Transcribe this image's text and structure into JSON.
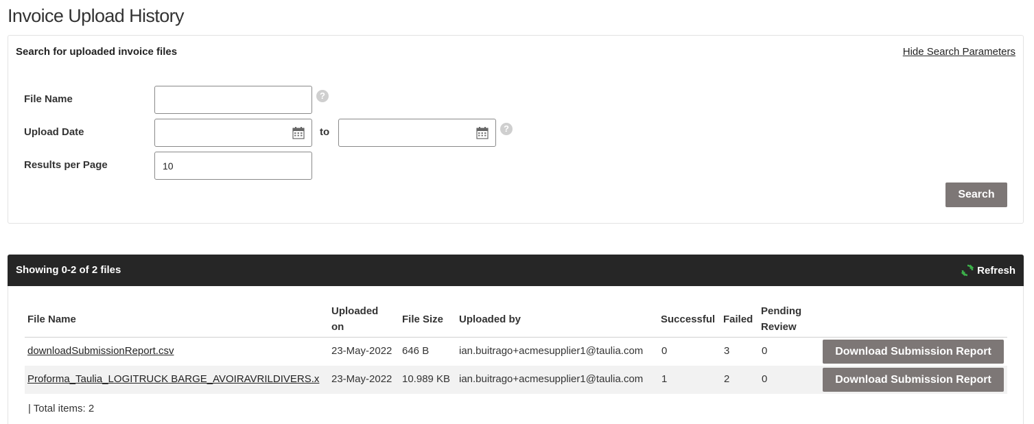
{
  "page": {
    "title": "Invoice Upload History"
  },
  "search": {
    "heading": "Search for uploaded invoice files",
    "hide_link": "Hide Search Parameters",
    "file_name_label": "File Name",
    "file_name_value": "",
    "upload_date_label": "Upload Date",
    "to_label": "to",
    "date_from_value": "",
    "date_to_value": "",
    "results_per_page_label": "Results per Page",
    "results_per_page_value": "10",
    "search_button": "Search",
    "help_glyph": "?",
    "icons": {
      "help": "question-circle-icon",
      "calendar": "calendar-icon"
    }
  },
  "results": {
    "summary": "Showing 0-2 of 2 files",
    "refresh_label": "Refresh",
    "columns": {
      "file_name": "File Name",
      "uploaded_on_1": "Uploaded",
      "uploaded_on_2": "on",
      "file_size": "File Size",
      "uploaded_by": "Uploaded by",
      "successful": "Successful",
      "failed": "Failed",
      "pending_1": "Pending",
      "pending_2": "Review"
    },
    "rows": [
      {
        "file_name": "downloadSubmissionReport.csv",
        "uploaded_on": "23-May-2022",
        "file_size": "646 B",
        "uploaded_by": "ian.buitrago+acmesupplier1@taulia.com",
        "successful": "0",
        "failed": "3",
        "pending_review": "0",
        "action": "Download Submission Report"
      },
      {
        "file_name": "Proforma_Taulia_LOGITRUCK BARGE_AVOIRAVRILDIVERS.x",
        "uploaded_on": "23-May-2022",
        "file_size": "10.989 KB",
        "uploaded_by": "ian.buitrago+acmesupplier1@taulia.com",
        "successful": "1",
        "failed": "2",
        "pending_review": "0",
        "action": "Download Submission Report"
      }
    ],
    "total": "| Total items: 2"
  },
  "colors": {
    "header_bar": "#262626",
    "button": "#7d7776",
    "refresh_icon": "#3cb04a",
    "alt_row": "#f2f2f2"
  }
}
